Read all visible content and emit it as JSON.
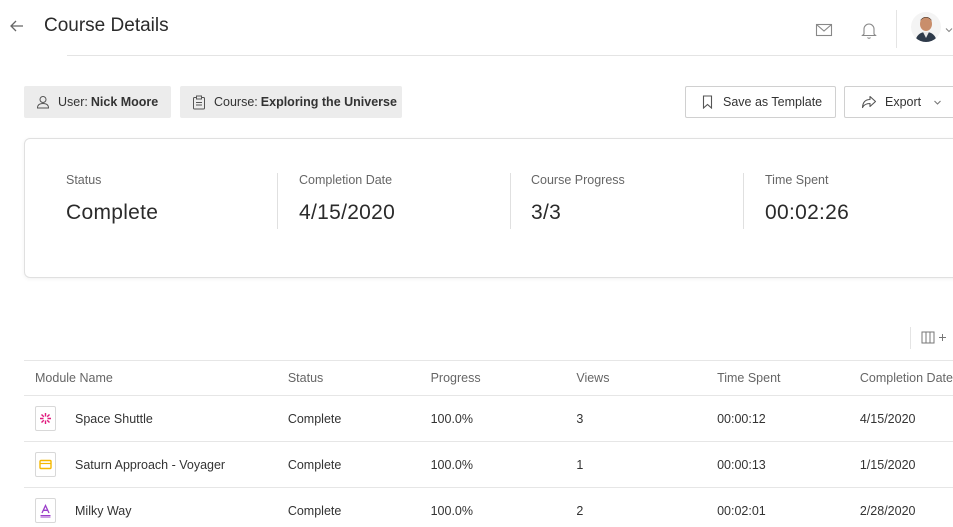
{
  "header": {
    "title": "Course Details",
    "icons": [
      "back-arrow-icon",
      "mail-icon",
      "bell-icon",
      "user-avatar",
      "chevron-down-icon"
    ]
  },
  "filters": {
    "user_label": "User:",
    "user_value": "Nick Moore",
    "course_label": "Course:",
    "course_value": "Exploring the Universe"
  },
  "actions": {
    "save_template": "Save as Template",
    "export": "Export"
  },
  "summary": [
    {
      "label": "Status",
      "value": "Complete"
    },
    {
      "label": "Completion Date",
      "value": "4/15/2020"
    },
    {
      "label": "Course Progress",
      "value": "3/3"
    },
    {
      "label": "Time Spent",
      "value": "00:02:26"
    }
  ],
  "table": {
    "columns": [
      "Module Name",
      "Status",
      "Progress",
      "Views",
      "Time Spent",
      "Completion Date"
    ],
    "rows": [
      {
        "icon": "shuttle-module-icon",
        "icon_color": "#e0197d",
        "name": "Space Shuttle",
        "status": "Complete",
        "progress": "100.0%",
        "views": "3",
        "time": "00:00:12",
        "date": "4/15/2020"
      },
      {
        "icon": "presentation-module-icon",
        "icon_color": "#f5b800",
        "name": "Saturn Approach - Voyager",
        "status": "Complete",
        "progress": "100.0%",
        "views": "1",
        "time": "00:00:13",
        "date": "1/15/2020"
      },
      {
        "icon": "document-module-icon",
        "icon_color": "#9b3fc9",
        "name": "Milky Way",
        "status": "Complete",
        "progress": "100.0%",
        "views": "2",
        "time": "00:02:01",
        "date": "2/28/2020"
      }
    ]
  }
}
